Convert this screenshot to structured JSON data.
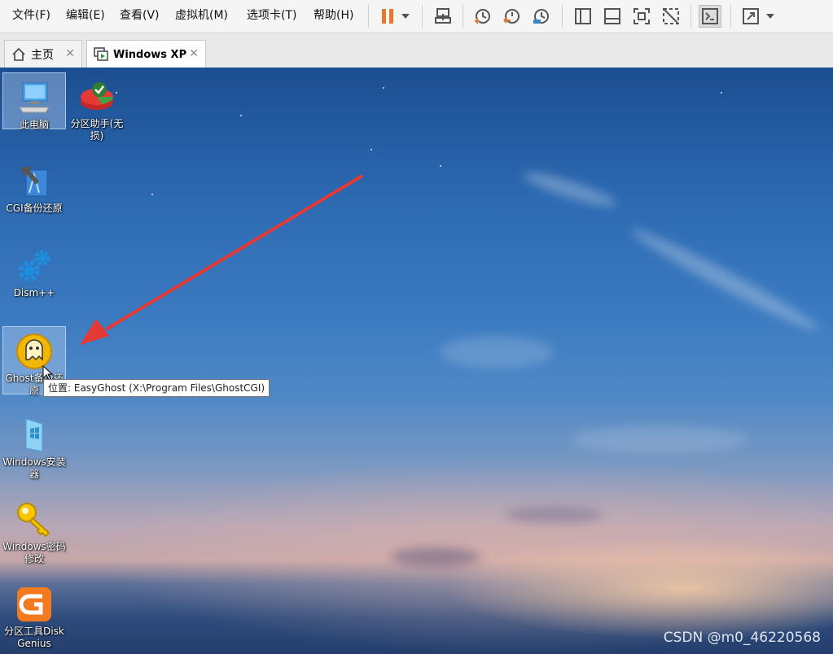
{
  "menubar": {
    "items": [
      "文件(F)",
      "编辑(E)",
      "查看(V)",
      "虚拟机(M)",
      "选项卡(T)",
      "帮助(H)"
    ],
    "toolbar_icons": [
      "pause-icon",
      "dropdown-icon",
      "send-ctrl-alt-del-icon",
      "snapshot-icon",
      "revert-snapshot-icon",
      "snapshot-manager-icon",
      "sidebar-icon",
      "thumbnail-bar-icon",
      "fullscreen-icon",
      "unity-icon",
      "console-view-icon",
      "stretch-icon",
      "dropdown-icon"
    ],
    "accent": "#e8772e"
  },
  "tabs": [
    {
      "label": "主页",
      "icon": "home-icon"
    },
    {
      "label": "Windows XP",
      "icon": "vm-icon",
      "active": true
    }
  ],
  "desktop": {
    "icons": [
      {
        "label": "此电脑",
        "icon": "computer-icon",
        "selected": true
      },
      {
        "label": "分区助手(无损)",
        "icon": "partition-assistant-icon"
      },
      {
        "label": "CGI备份还原",
        "icon": "cgi-backup-icon"
      },
      {
        "label": "Dism++",
        "icon": "gears-icon"
      },
      {
        "label": "Ghost备份还原",
        "icon": "ghost-icon",
        "selected": true
      },
      {
        "label": "Windows安装器",
        "icon": "windows-installer-icon"
      },
      {
        "label": "Windows密码修改",
        "icon": "key-icon"
      },
      {
        "label": "分区工具DiskGenius",
        "icon": "diskgenius-icon"
      }
    ],
    "tooltip": "位置: EasyGhost (X:\\Program Files\\GhostCGI)",
    "watermark": "CSDN @m0_46220568",
    "annotation_color": "#e53935"
  }
}
